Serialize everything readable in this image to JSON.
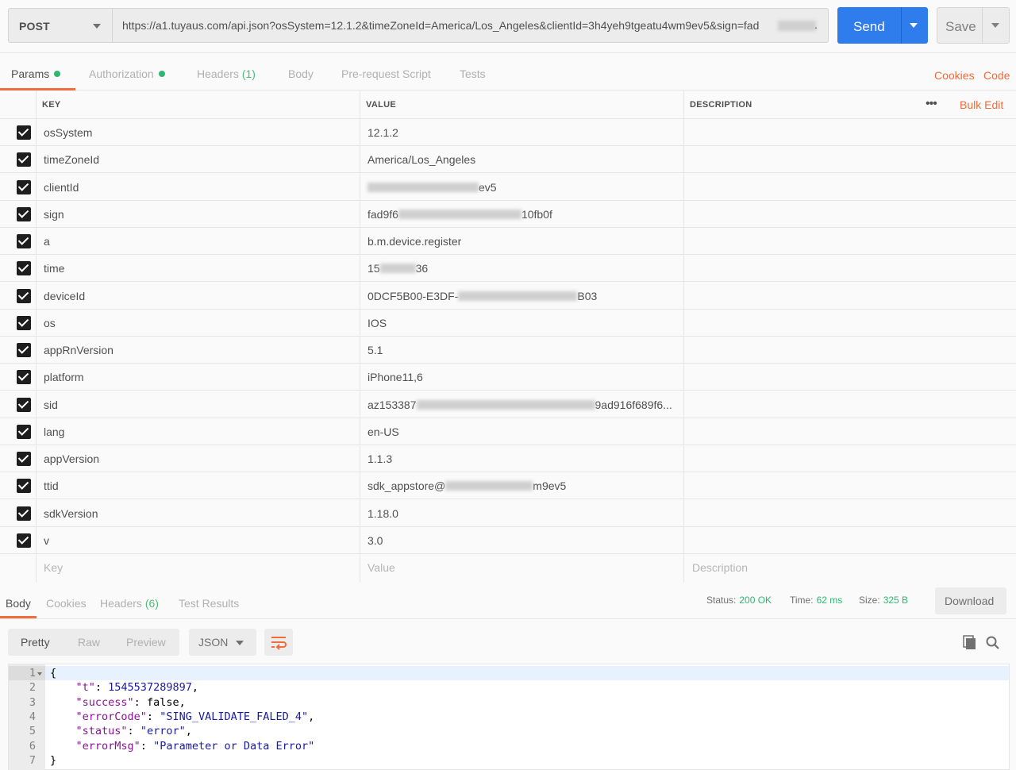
{
  "request": {
    "method": "POST",
    "url": "https://a1.tuyaus.com/api.json?osSystem=12.1.2&timeZoneId=America/Los_Angeles&clientId=3h4yeh9tgeatu4wm9ev5&sign=fad",
    "url_trail": ".",
    "send_label": "Send",
    "save_label": "Save"
  },
  "request_tabs": {
    "params": "Params",
    "authorization": "Authorization",
    "headers": "Headers",
    "headers_count": "(1)",
    "body": "Body",
    "prerequest": "Pre-request Script",
    "tests": "Tests",
    "cookies": "Cookies",
    "code": "Code"
  },
  "params_table": {
    "col_key": "KEY",
    "col_value": "VALUE",
    "col_description": "DESCRIPTION",
    "more": "•••",
    "bulk_edit": "Bulk Edit",
    "rows": [
      {
        "key": "osSystem",
        "value": "12.1.2",
        "value_pre": "",
        "value_post": ""
      },
      {
        "key": "timeZoneId",
        "value": "America/Los_Angeles",
        "value_pre": "",
        "value_post": ""
      },
      {
        "key": "clientId",
        "value": "",
        "value_pre": "",
        "value_post": "ev5"
      },
      {
        "key": "sign",
        "value": "",
        "value_pre": "fad9f6",
        "value_post": "10fb0f"
      },
      {
        "key": "a",
        "value": "b.m.device.register",
        "value_pre": "",
        "value_post": ""
      },
      {
        "key": "time",
        "value": "",
        "value_pre": "15",
        "value_post": "36"
      },
      {
        "key": "deviceId",
        "value": "",
        "value_pre": "0DCF5B00-E3DF-",
        "value_post": "B03"
      },
      {
        "key": "os",
        "value": "IOS",
        "value_pre": "",
        "value_post": ""
      },
      {
        "key": "appRnVersion",
        "value": "5.1",
        "value_pre": "",
        "value_post": ""
      },
      {
        "key": "platform",
        "value": "iPhone11,6",
        "value_pre": "",
        "value_post": ""
      },
      {
        "key": "sid",
        "value": "",
        "value_pre": "az153387",
        "value_post": "9ad916f689f6..."
      },
      {
        "key": "lang",
        "value": "en-US",
        "value_pre": "",
        "value_post": ""
      },
      {
        "key": "appVersion",
        "value": "1.1.3",
        "value_pre": "",
        "value_post": ""
      },
      {
        "key": "ttid",
        "value": "",
        "value_pre": "sdk_appstore@",
        "value_post": "m9ev5"
      },
      {
        "key": "sdkVersion",
        "value": "1.18.0",
        "value_pre": "",
        "value_post": ""
      },
      {
        "key": "v",
        "value": "3.0",
        "value_pre": "",
        "value_post": ""
      }
    ],
    "placeholder_key": "Key",
    "placeholder_value": "Value",
    "placeholder_description": "Description"
  },
  "response_tabs": {
    "body": "Body",
    "cookies": "Cookies",
    "headers": "Headers",
    "headers_count": "(6)",
    "test_results": "Test Results",
    "status_label": "Status:",
    "status_value": "200 OK",
    "time_label": "Time:",
    "time_value": "62 ms",
    "size_label": "Size:",
    "size_value": "325 B",
    "download": "Download"
  },
  "response_toolbar": {
    "pretty": "Pretty",
    "raw": "Raw",
    "preview": "Preview",
    "format": "JSON"
  },
  "response_body": {
    "line_numbers": [
      "1",
      "2",
      "3",
      "4",
      "5",
      "6",
      "7"
    ],
    "lines": [
      {
        "indent": "",
        "key": "",
        "sep": "",
        "val": "{",
        "tail": ""
      },
      {
        "indent": "    ",
        "key": "\"t\"",
        "sep": ": ",
        "val": "1545537289897",
        "tail": ","
      },
      {
        "indent": "    ",
        "key": "\"success\"",
        "sep": ": ",
        "val": "false",
        "tail": ","
      },
      {
        "indent": "    ",
        "key": "\"errorCode\"",
        "sep": ": ",
        "val": "\"SING_VALIDATE_FALED_4\"",
        "tail": ","
      },
      {
        "indent": "    ",
        "key": "\"status\"",
        "sep": ": ",
        "val": "\"error\"",
        "tail": ","
      },
      {
        "indent": "    ",
        "key": "\"errorMsg\"",
        "sep": ": ",
        "val": "\"Parameter or Data Error\"",
        "tail": ""
      },
      {
        "indent": "",
        "key": "",
        "sep": "",
        "val": "}",
        "tail": ""
      }
    ]
  },
  "colors": {
    "accent": "#f26b3a",
    "send": "#2f7ded",
    "success": "#2fb670"
  }
}
